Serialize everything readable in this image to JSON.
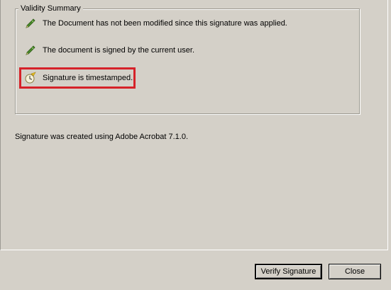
{
  "validity_summary": {
    "legend": "Validity Summary",
    "items": [
      {
        "icon": "pen-check-icon",
        "text": "The Document has not been modified since this signature was applied."
      },
      {
        "icon": "pen-check-icon",
        "text": "The document is signed by the current user."
      },
      {
        "icon": "clock-timestamp-icon",
        "text": "Signature is timestamped."
      }
    ]
  },
  "footer_text": "Signature was created using Adobe Acrobat 7.1.0.",
  "buttons": {
    "verify": "Verify Signature",
    "close": "Close"
  },
  "colors": {
    "background": "#d4d0c8",
    "highlight": "#d62229",
    "pen_green": "#4a8a2a"
  }
}
